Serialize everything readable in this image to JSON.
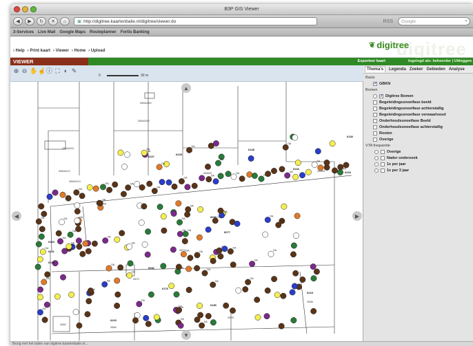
{
  "window": {
    "title": "B3P GIS Viewer"
  },
  "browser": {
    "url": "http://digitree.kaartenbalie.nl/digitree/viewer.do",
    "rss_label": "RSS",
    "search_placeholder": "Google",
    "bookmarks": [
      "3-Services",
      "Live Mail",
      "Google Maps",
      "Routeplanner",
      "Fortis Banking"
    ]
  },
  "site": {
    "menu": [
      "› Help",
      "› Print kaart",
      "› Viewer",
      "› Home",
      "› Upload"
    ],
    "logo": "digitree",
    "logo_ghost": "digitree",
    "page_label": "VIEWER",
    "export_label": "Exporteer kaart",
    "logged_in": "Ingelogd als: beheerder | Uitloggen"
  },
  "map": {
    "scale_left": "0",
    "scale_right": "30 m",
    "parcel_labels": [
      "2854/292",
      "2854/292",
      "2854/293",
      "2854/212",
      "2854/213",
      "2854/2",
      "2855/I",
      "2874",
      "2872",
      "2862",
      "2860",
      "2856",
      "2876"
    ],
    "tree_ids": [
      "6130",
      "6138",
      "6227",
      "6228",
      "6234",
      "6233",
      "6069",
      "6077",
      "6160",
      "6161",
      "6162",
      "6082",
      "6176",
      "6218",
      "6223",
      "6180"
    ],
    "tree_label": "OA",
    "colors": {
      "brown": "#5a3418",
      "purple": "#7a2a8a",
      "blue": "#2a3ec8",
      "green": "#2a7a3a",
      "yellow": "#f4ee50",
      "orange": "#e07a2a",
      "white": "#ffffff"
    }
  },
  "panel": {
    "tabs": [
      "Thema's",
      "Legenda",
      "Zoeker",
      "Gebieden",
      "Analyse"
    ],
    "groups": [
      {
        "title": "Basis",
        "items": [
          {
            "label": "GBKN",
            "checked": true,
            "radio": false
          }
        ]
      },
      {
        "title": "Bomen",
        "items": [
          {
            "label": "Digitree Bomen",
            "checked": true,
            "radio": true
          },
          {
            "label": "Begeleidingssnoeifase beeld",
            "checked": false,
            "radio": false
          },
          {
            "label": "Begeleidingssnoeifase achterstallig",
            "checked": false,
            "radio": false
          },
          {
            "label": "Begeleidingssnoeifase verwaarloosd",
            "checked": false,
            "radio": false
          },
          {
            "label": "Onderhoudssnoeifase Beeld",
            "checked": false,
            "radio": false
          },
          {
            "label": "Onderhoudssnoeifase achterstallig",
            "checked": false,
            "radio": false
          },
          {
            "label": "Rooien",
            "checked": false,
            "radio": false
          },
          {
            "label": "Overige",
            "checked": false,
            "radio": false
          }
        ]
      },
      {
        "title": "VTA frequentie",
        "items": [
          {
            "label": "Overige",
            "checked": false,
            "radio": true
          },
          {
            "label": "Nader onderzoek",
            "checked": false,
            "radio": true
          },
          {
            "label": "1x per jaar",
            "checked": false,
            "radio": true
          },
          {
            "label": "1x per 3 jaar",
            "checked": false,
            "radio": true
          }
        ]
      }
    ]
  },
  "status": "Bezig met het laden van digitree.kaartenbalie.nl..."
}
